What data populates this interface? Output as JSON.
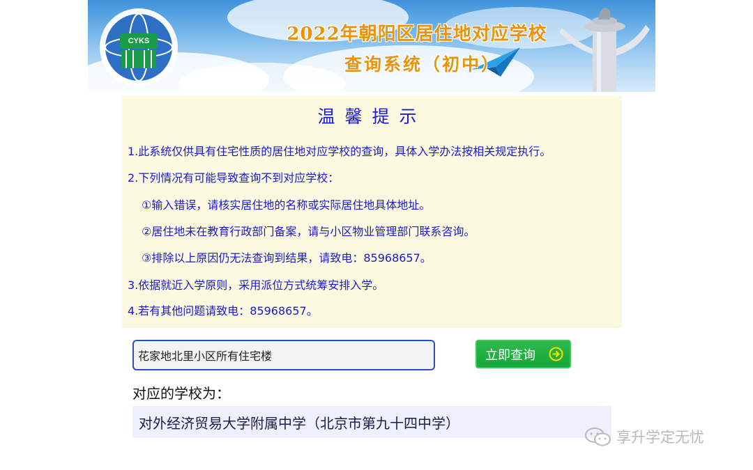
{
  "banner": {
    "title": "2022年朝阳区居住地对应学校",
    "subtitle": "查询系统（初中）",
    "logo_text": "CYKS"
  },
  "notice": {
    "title": "温馨提示",
    "lines": [
      "1.此系统仅供具有住宅性质的居住地对应学校的查询，具体入学办法按相关规定执行。",
      "2.下列情况有可能导致查询不到对应学校：",
      "①输入错误，请核实居住地的名称或实际居住地具体地址。",
      "②居住地未在教育行政部门备案，请与小区物业管理部门联系咨询。",
      "③排除以上原因仍无法查询到结果，请致电：85968657。",
      "3.依据就近入学原则，采用派位方式统筹安排入学。",
      "4.若有其他问题请致电：85968657。"
    ]
  },
  "search": {
    "value": "花家地北里小区所有住宅楼",
    "button_label": "立即查询"
  },
  "result": {
    "label": "对应的学校为：",
    "value": "对外经济贸易大学附属中学（北京市第九十四中学）"
  },
  "watermark": {
    "text": "享升学定无忧"
  },
  "colors": {
    "notice_text": "#1a1ac8",
    "notice_bg": "#fbf9e0",
    "button_green": "#16a83a",
    "banner_orange": "#e8930c"
  }
}
